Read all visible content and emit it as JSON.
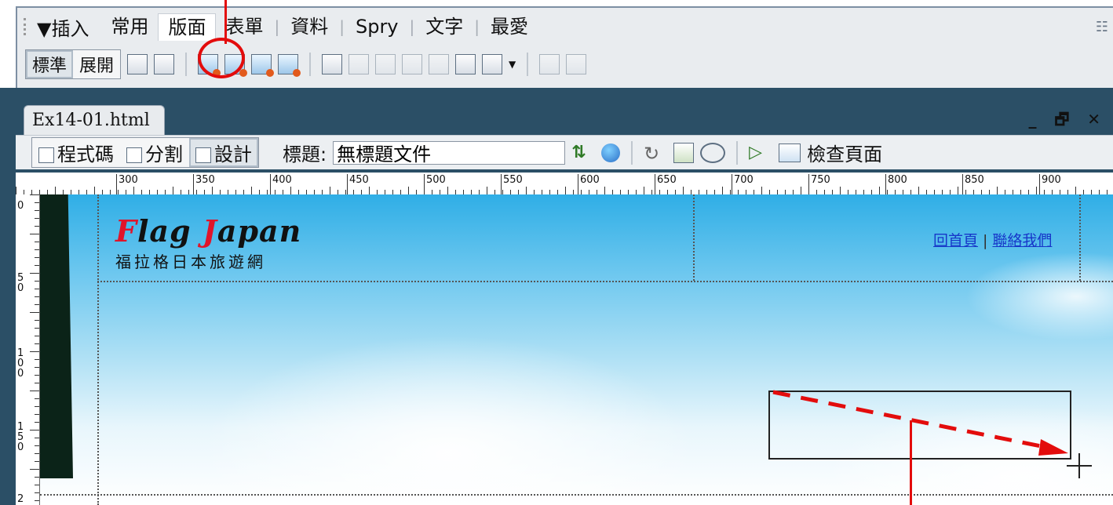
{
  "insert_bar": {
    "title": "▼插入",
    "tabs": [
      "常用",
      "版面",
      "表單",
      "資料",
      "Spry",
      "文字",
      "最愛"
    ],
    "active_tab_index": 1,
    "mode_buttons": [
      "標準",
      "展開"
    ],
    "active_mode_index": 0
  },
  "document": {
    "filename": "Ex14-01.html",
    "window_controls": "_ 🗗 ✕",
    "view_buttons": [
      "程式碼",
      "分割",
      "設計"
    ],
    "active_view_index": 2,
    "title_label": "標題:",
    "title_value": "無標題文件",
    "check_page_label": "檢查頁面"
  },
  "ruler": {
    "h_labels": [
      "300",
      "350",
      "400",
      "450",
      "500",
      "550",
      "600",
      "650",
      "700",
      "750",
      "800",
      "850",
      "900"
    ],
    "v_labels": [
      "0",
      "50",
      "100",
      "150",
      "2"
    ]
  },
  "page": {
    "logo_parts": [
      "F",
      "lag ",
      "J",
      "apan"
    ],
    "logo_sub": "福拉格日本旅遊網",
    "links": [
      "回首頁",
      "聯絡我們"
    ],
    "link_separator": "|"
  },
  "colors": {
    "annotation_red": "#e30c0c",
    "logo_red": "#e0142a",
    "link_blue": "#1737c9"
  }
}
